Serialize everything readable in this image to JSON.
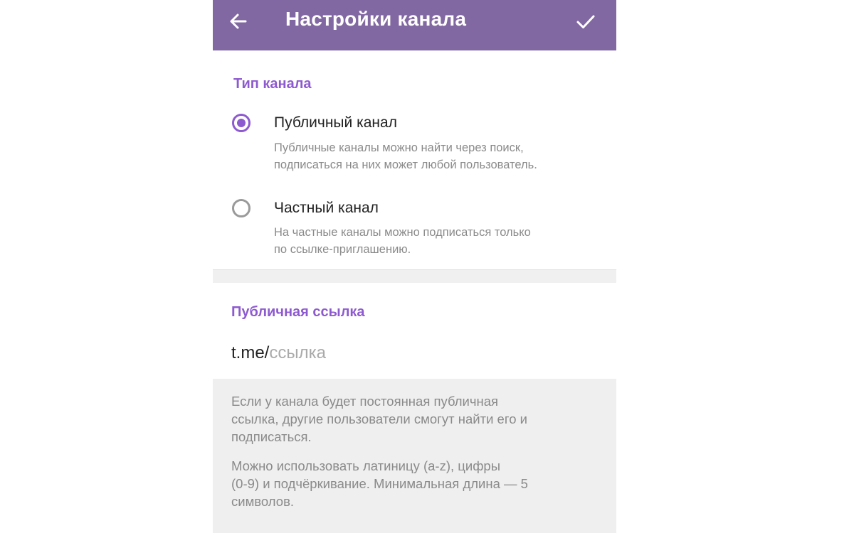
{
  "header": {
    "title": "Настройки канала",
    "back_icon": "arrow-left-icon",
    "done_icon": "checkmark-icon",
    "background_color": "#8268a2"
  },
  "channel_type": {
    "section_title": "Тип канала",
    "options": [
      {
        "title": "Публичный канал",
        "description_lines": [
          "Публичные каналы можно найти через поиск,",
          "подписаться на них может любой пользователь."
        ],
        "selected": true
      },
      {
        "title": "Частный канал",
        "description_lines": [
          "На частные каналы можно подписаться только",
          "по ссылке-приглашению."
        ],
        "selected": false
      }
    ]
  },
  "public_link": {
    "section_title": "Публичная ссылка",
    "prefix": "t.me/",
    "value": "",
    "placeholder": "ссылка"
  },
  "info": {
    "paragraph1_lines": [
      "Если у канала будет постоянная публичная",
      "ссылка, другие пользователи смогут найти его и",
      "подписаться."
    ],
    "paragraph2_lines": [
      "Можно использовать латиницу (a-z), цифры",
      "(0-9) и подчёркивание. Минимальная длина — 5",
      "символов."
    ]
  },
  "colors": {
    "accent": "#8e5ad0",
    "secondary_text": "#8a8a8a",
    "info_background": "#efefef"
  }
}
